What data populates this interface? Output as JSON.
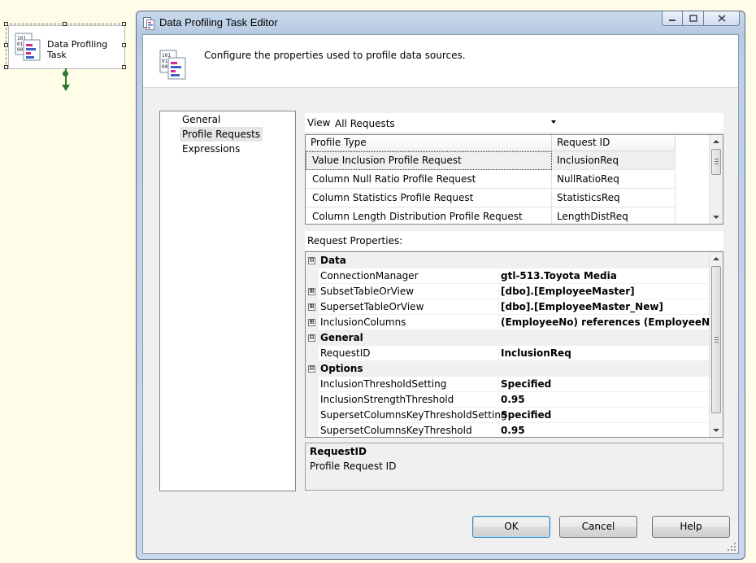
{
  "canvas": {
    "task": {
      "label": "Data Profiling Task"
    }
  },
  "dialog": {
    "title": "Data Profiling Task Editor",
    "header_text": "Configure the properties used to profile data sources."
  },
  "nav": {
    "items": [
      {
        "label": "General"
      },
      {
        "label": "Profile Requests"
      },
      {
        "label": "Expressions"
      }
    ]
  },
  "view": {
    "label": "View",
    "selected": "All Requests"
  },
  "requests": {
    "columns": [
      "Profile Type",
      "Request ID"
    ],
    "rows": [
      {
        "profile_type": "Value Inclusion Profile Request",
        "request_id": "InclusionReq"
      },
      {
        "profile_type": "Column Null Ratio Profile Request",
        "request_id": "NullRatioReq"
      },
      {
        "profile_type": "Column Statistics Profile Request",
        "request_id": "StatisticsReq"
      },
      {
        "profile_type": "Column Length Distribution Profile Request",
        "request_id": "LengthDistReq"
      }
    ]
  },
  "properties": {
    "label": "Request Properties:",
    "rows": [
      {
        "kind": "category",
        "name": "Data",
        "expander": "⊟"
      },
      {
        "kind": "prop",
        "name": "ConnectionManager",
        "value": "gtl-513.Toyota Media"
      },
      {
        "kind": "prop",
        "name": "SubsetTableOrView",
        "value": "[dbo].[EmployeeMaster]",
        "expander": "⊞"
      },
      {
        "kind": "prop",
        "name": "SupersetTableOrView",
        "value": "[dbo].[EmployeeMaster_New]",
        "expander": "⊞"
      },
      {
        "kind": "prop",
        "name": "InclusionColumns",
        "value": "(EmployeeNo) references (EmployeeNo)",
        "expander": "⊞"
      },
      {
        "kind": "category",
        "name": "General",
        "expander": "⊟"
      },
      {
        "kind": "prop",
        "name": "RequestID",
        "value": "InclusionReq"
      },
      {
        "kind": "category",
        "name": "Options",
        "expander": "⊟"
      },
      {
        "kind": "prop",
        "name": "InclusionThresholdSetting",
        "value": "Specified"
      },
      {
        "kind": "prop",
        "name": "InclusionStrengthThreshold",
        "value": "0.95"
      },
      {
        "kind": "prop",
        "name": "SupersetColumnsKeyThresholdSetting",
        "value": "Specified"
      },
      {
        "kind": "prop",
        "name": "SupersetColumnsKeyThreshold",
        "value": "0.95"
      }
    ]
  },
  "description": {
    "title": "RequestID",
    "text": "Profile Request ID"
  },
  "buttons": {
    "ok": "OK",
    "cancel": "Cancel",
    "help": "Help"
  },
  "colors": {
    "canvas_bg": "#fffde8",
    "connector": "#2b7a2b",
    "selection": "#efefef",
    "default_button_border": "#3c7fb1"
  }
}
